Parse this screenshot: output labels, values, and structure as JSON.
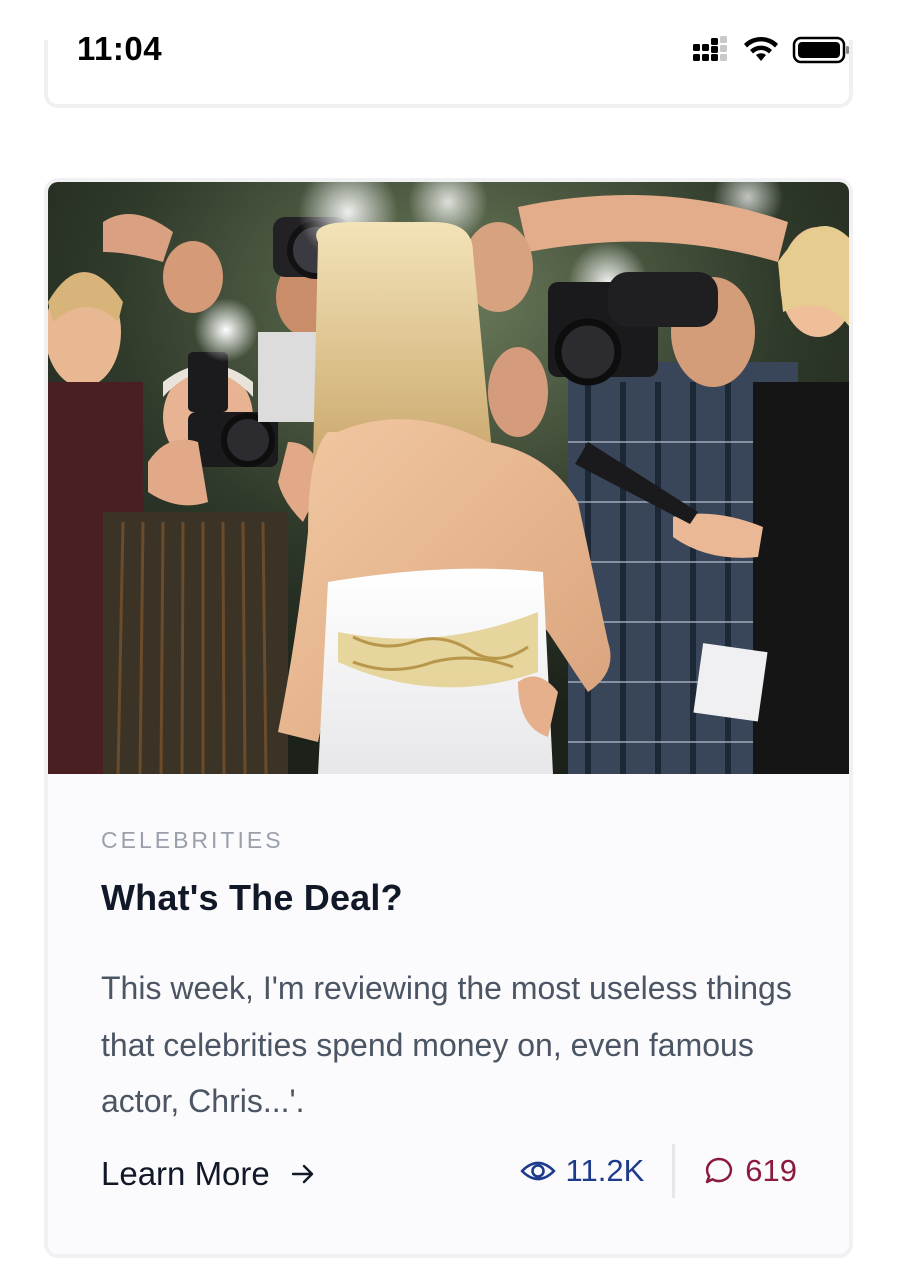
{
  "status_bar": {
    "time": "11:04",
    "icons": [
      "signal-icon",
      "wifi-icon",
      "battery-icon"
    ]
  },
  "card": {
    "image": {
      "description_icon": "photo",
      "alt": ""
    },
    "category": "CELEBRITIES",
    "title": "What's The Deal?",
    "excerpt": "This week, I'm reviewing the most useless things that celebrities spend money on, even famous actor, Chris...'.",
    "learn_more_label": "Learn More",
    "views": "11.2K",
    "comments": "619",
    "colors": {
      "views": "#1e3a8a",
      "comments": "#8b1a3f",
      "category": "#9aa0ab",
      "title": "#111827",
      "excerpt": "#4b5563"
    }
  }
}
